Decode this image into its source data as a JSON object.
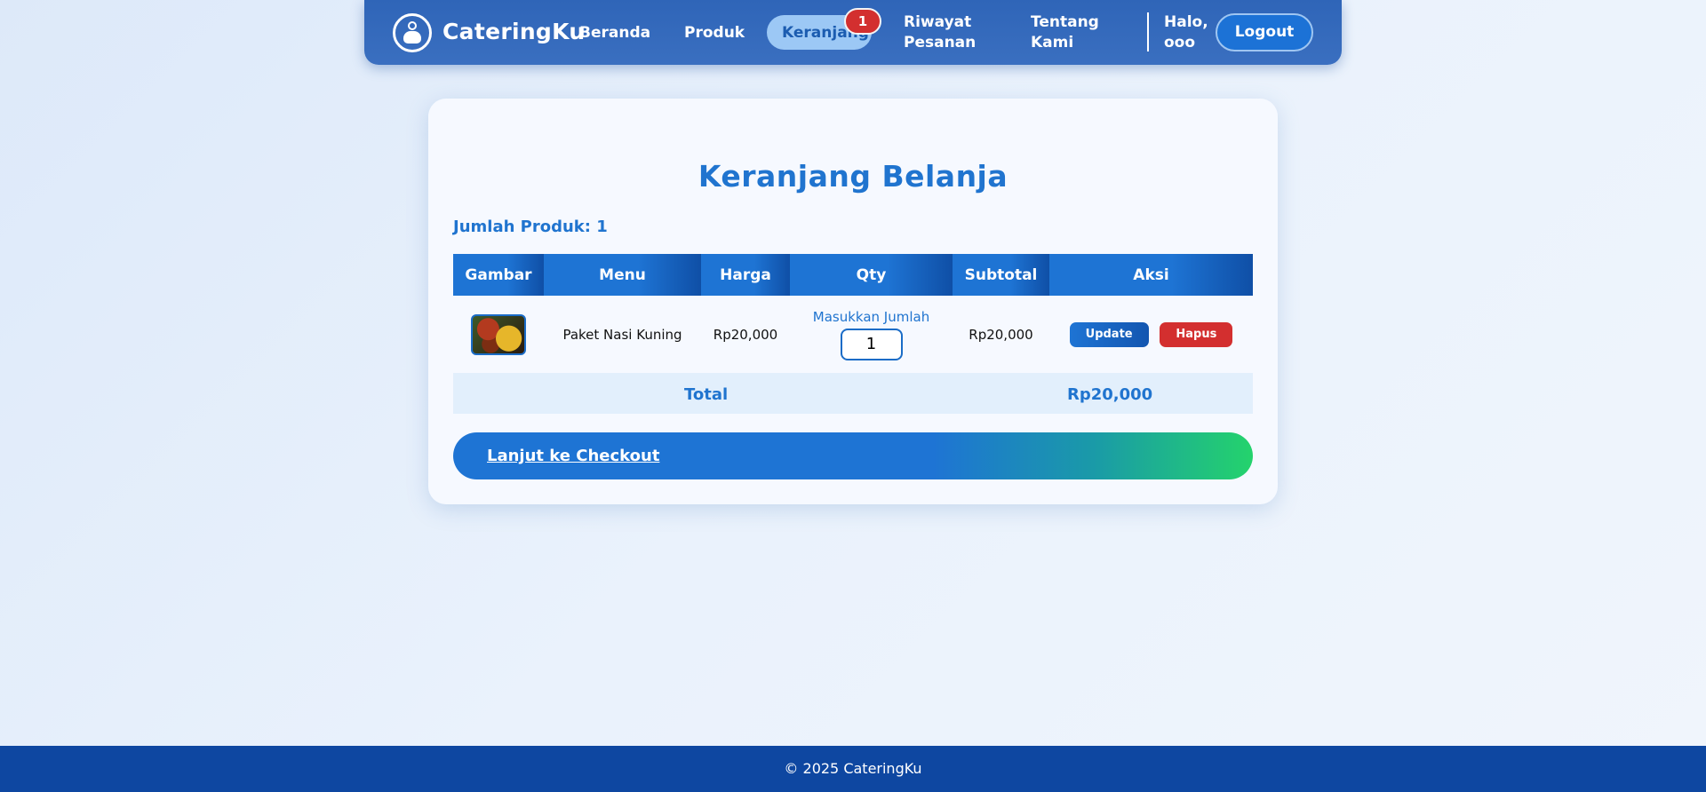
{
  "nav": {
    "brand": "CateringKu",
    "links": [
      "Beranda",
      "Produk",
      "Keranjang",
      "Riwayat Pesanan",
      "Tentang Kami"
    ],
    "riwayat_line1": "Riwayat",
    "riwayat_line2": "Pesanan",
    "tentang_line1": "Tentang",
    "tentang_line2": "Kami",
    "cart_badge": "1",
    "greeting_line1": "Halo,",
    "greeting_line2": "ooo",
    "logout_label": "Logout"
  },
  "page": {
    "title": "Keranjang Belanja",
    "product_count": "Jumlah Produk: 1"
  },
  "table": {
    "headers": [
      "Gambar",
      "Menu",
      "Harga",
      "Qty",
      "Subtotal",
      "Aksi"
    ],
    "rows": [
      {
        "menu": "Paket Nasi Kuning",
        "price": "Rp20,000",
        "qty_label": "Masukkan Jumlah",
        "qty_value": "1",
        "subtotal": "Rp20,000",
        "update_label": "Update",
        "delete_label": "Hapus"
      }
    ],
    "total_label": "Total",
    "total_value": "Rp20,000"
  },
  "checkout_label": "Lanjut ke Checkout",
  "footer": "© 2025 CateringKu",
  "colors": {
    "primary": "#2074cf",
    "nav_bg": "#2f65b8",
    "danger": "#d32f2f",
    "footer_bg": "#0e47a1",
    "checkout_end": "#24d36c"
  }
}
